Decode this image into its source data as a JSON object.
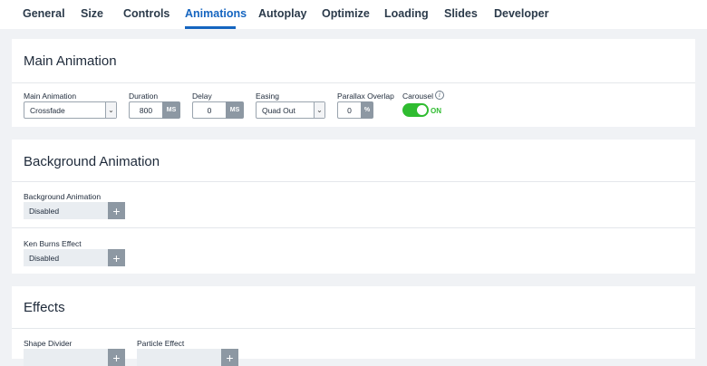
{
  "tabs": [
    {
      "label": "General"
    },
    {
      "label": "Size"
    },
    {
      "label": "Controls"
    },
    {
      "label": "Animations"
    },
    {
      "label": "Autoplay"
    },
    {
      "label": "Optimize"
    },
    {
      "label": "Loading"
    },
    {
      "label": "Slides"
    },
    {
      "label": "Developer"
    }
  ],
  "active_tab": "Animations",
  "accent_color": "#1565c0",
  "toggle_color": "#2fbc30",
  "main_animation": {
    "title": "Main Animation",
    "main_animation": {
      "label": "Main Animation",
      "value": "Crossfade"
    },
    "duration": {
      "label": "Duration",
      "value": "800",
      "unit": "MS"
    },
    "delay": {
      "label": "Delay",
      "value": "0",
      "unit": "MS"
    },
    "easing": {
      "label": "Easing",
      "value": "Quad Out"
    },
    "parallax": {
      "label": "Parallax Overlap",
      "value": "0",
      "unit": "%"
    },
    "carousel": {
      "label": "Carousel",
      "state": "ON",
      "info_icon": "info-icon"
    }
  },
  "background_animation": {
    "title": "Background Animation",
    "background": {
      "label": "Background Animation",
      "value": "Disabled"
    },
    "ken_burns": {
      "label": "Ken Burns Effect",
      "value": "Disabled"
    }
  },
  "effects": {
    "title": "Effects",
    "shape_divider": {
      "label": "Shape Divider"
    },
    "particle": {
      "label": "Particle Effect"
    }
  }
}
